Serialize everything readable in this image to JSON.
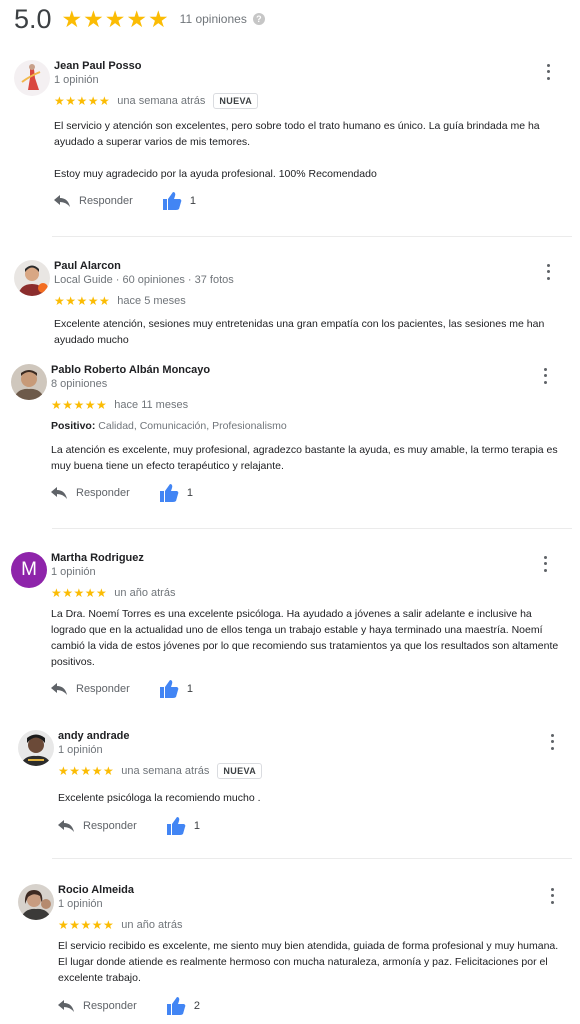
{
  "summary": {
    "score": "5.0",
    "stars": "★★★★★",
    "count_text": "11 opiniones",
    "help_glyph": "?"
  },
  "colors": {
    "star": "#fbbc04",
    "like": "#4285f4",
    "avatar_m": "#8e24aa"
  },
  "ui": {
    "reply_label": "Responder",
    "positive_label": "Positivo:"
  },
  "reviews": [
    {
      "name": "Jean Paul Posso",
      "meta": "1 opinión",
      "stars": "★★★★★",
      "when": "una semana atrás",
      "badge": "NUEVA",
      "text": "El servicio y atención son excelentes, pero sobre todo el trato humano es único. La guía brindada me ha ayudado a superar varios de mis temores.\n\nEstoy muy agradecido por la ayuda profesional. 100% Recomendado",
      "likes": "1"
    },
    {
      "name": "Paul Alarcon",
      "meta": "Local Guide · 60 opiniones · 37 fotos",
      "stars": "★★★★★",
      "when": "hace 5 meses",
      "text": "Excelente atención, sesiones muy entretenidas una gran empatía con los pacientes, las sesiones me han ayudado mucho"
    },
    {
      "name": "Pablo Roberto Albán Moncayo",
      "meta": "8 opiniones",
      "stars": "★★★★★",
      "when": "hace 11 meses",
      "positive": "Calidad, Comunicación, Profesionalismo",
      "text": "La atención es excelente, muy profesional, agradezco bastante la ayuda, es muy amable, la termo terapia es muy buena tiene un efecto terapéutico y relajante.",
      "likes": "1"
    },
    {
      "name": "Martha Rodriguez",
      "initial": "M",
      "meta": "1 opinión",
      "stars": "★★★★★",
      "when": "un año atrás",
      "text": "La Dra. Noemí Torres es una excelente psicóloga. Ha ayudado a jóvenes a salir adelante e inclusive ha logrado que en la actualidad uno de ellos tenga un trabajo estable y haya terminado una maestría. Noemí cambió la vida de estos jóvenes por lo que recomiendo sus tratamientos ya que los resultados son altamente positivos.",
      "likes": "1"
    },
    {
      "name": "andy andrade",
      "meta": "1 opinión",
      "stars": "★★★★★",
      "when": "una semana atrás",
      "badge": "NUEVA",
      "text": "Excelente psicóloga  la recomiendo mucho .",
      "likes": "1"
    },
    {
      "name": "Rocio Almeida",
      "meta": "1 opinión",
      "stars": "★★★★★",
      "when": "un año atrás",
      "text": "El servicio recibido es excelente,  me siento muy bien atendida,  guiada de forma profesional y muy humana.  El lugar donde atiende es realmente hermoso con mucha naturaleza,  armonía y paz. Felicitaciones por el excelente trabajo.",
      "likes": "2"
    }
  ]
}
